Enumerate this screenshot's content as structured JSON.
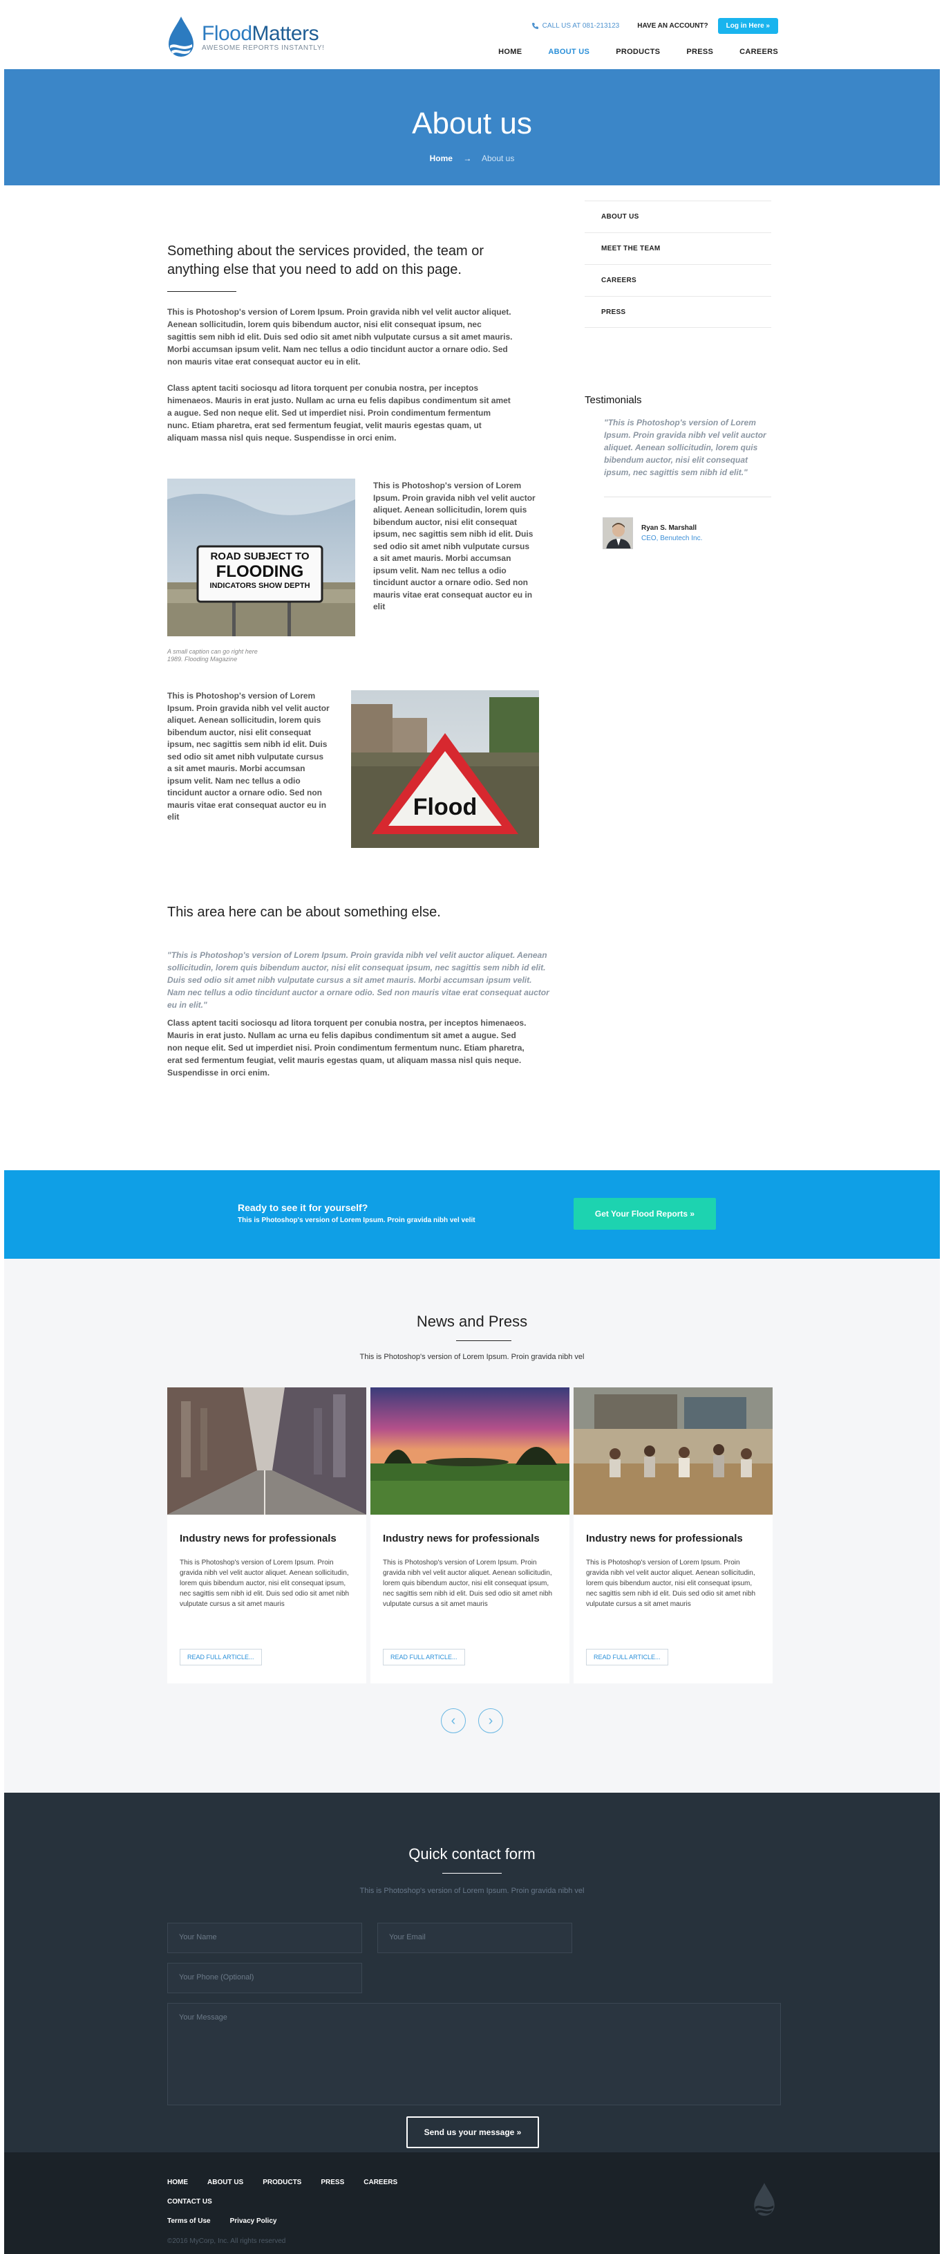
{
  "header": {
    "brand_first": "Flood",
    "brand_second": "Matters",
    "tagline": "AWESOME REPORTS INSTANTLY!",
    "call": "CALL US AT 081-213123",
    "account": "HAVE AN ACCOUNT?",
    "login": "Log in Here »",
    "nav": [
      {
        "label": "HOME",
        "active": false
      },
      {
        "label": "ABOUT US",
        "active": true
      },
      {
        "label": "PRODUCTS",
        "active": false
      },
      {
        "label": "PRESS",
        "active": false
      },
      {
        "label": "CAREERS",
        "active": false
      }
    ]
  },
  "hero": {
    "title": "About us",
    "breadcrumb_home": "Home",
    "breadcrumb_sep": "→",
    "breadcrumb_current": "About us"
  },
  "main": {
    "heading1": "Something about the services provided, the team or anything else that you need to add on this page.",
    "para1": "This is Photoshop's version of Lorem Ipsum. Proin gravida nibh vel velit auctor aliquet. Aenean sollicitudin, lorem quis bibendum auctor, nisi elit consequat ipsum, nec sagittis sem nibh id elit. Duis sed odio sit amet nibh vulputate cursus a sit amet mauris. Morbi accumsan ipsum velit. Nam nec tellus a odio tincidunt auctor a ornare odio. Sed non mauris vitae erat consequat auctor eu in elit.",
    "para2": "Class aptent taciti sociosqu ad litora torquent per conubia nostra, per inceptos himenaeos. Mauris in erat justo. Nullam ac urna eu felis dapibus condimentum sit amet a augue. Sed non neque elit. Sed ut imperdiet nisi. Proin condimentum fermentum nunc. Etiam pharetra, erat sed fermentum feugiat, velit mauris egestas quam, ut aliquam massa nisl quis neque. Suspendisse in orci enim.",
    "img1_sign": [
      "ROAD SUBJECT TO",
      "FLOODING",
      "INDICATORS SHOW DEPTH"
    ],
    "caption_line1": "A small caption can go right here",
    "caption_line2": "1989. Flooding Magazine",
    "side_text1": "This is Photoshop's version of Lorem Ipsum. Proin gravida nibh vel velit auctor aliquet. Aenean sollicitudin, lorem quis bibendum auctor, nisi elit consequat ipsum, nec sagittis sem nibh id elit. Duis sed odio sit amet nibh vulputate cursus a sit amet mauris. Morbi accumsan ipsum velit. Nam nec tellus a odio tincidunt auctor a ornare odio. Sed non mauris vitae erat consequat auctor eu in elit",
    "side_text2": "This is Photoshop's version of Lorem Ipsum. Proin gravida nibh vel velit auctor aliquet. Aenean sollicitudin, lorem quis bibendum auctor, nisi elit consequat ipsum, nec sagittis sem nibh id elit. Duis sed odio sit amet nibh vulputate cursus a sit amet mauris. Morbi accumsan ipsum velit. Nam nec tellus a odio tincidunt auctor a ornare odio. Sed non mauris vitae erat consequat auctor eu in elit",
    "img2_sign": "Flood",
    "heading2": "This area here can be about something else.",
    "quote": "\"This is Photoshop's version of Lorem Ipsum. Proin gravida nibh vel velit auctor aliquet. Aenean sollicitudin, lorem quis bibendum auctor, nisi elit consequat ipsum, nec sagittis sem nibh id elit. Duis sed odio sit amet nibh vulputate cursus a sit amet mauris. Morbi accumsan ipsum velit. Nam nec tellus a odio tincidunt auctor a ornare odio. Sed non mauris vitae erat consequat auctor eu in elit.\"",
    "para3": "Class aptent taciti sociosqu ad litora torquent per conubia nostra, per inceptos himenaeos. Mauris in erat justo. Nullam ac urna eu felis dapibus condimentum sit amet a augue. Sed non neque elit. Sed ut imperdiet nisi. Proin condimentum fermentum nunc. Etiam pharetra, erat sed fermentum feugiat, velit mauris egestas quam, ut aliquam massa nisl quis neque. Suspendisse in orci enim."
  },
  "sidebar": {
    "items": [
      "ABOUT US",
      "MEET THE TEAM",
      "CAREERS",
      "PRESS"
    ],
    "testimonials_title": "Testimonials",
    "testimonial_quote": "\"This is Photoshop's version of Lorem Ipsum. Proin gravida nibh vel velit auctor aliquet. Aenean sollicitudin, lorem quis bibendum auctor, nisi elit consequat ipsum, nec sagittis sem nibh id elit.\"",
    "person_name": "Ryan S. Marshall",
    "person_role": "CEO, Benutech Inc."
  },
  "cta": {
    "title": "Ready to see it for yourself?",
    "subtitle": "This is Photoshop's version of Lorem Ipsum. Proin gravida nibh vel velit",
    "button": "Get Your Flood Reports »"
  },
  "news": {
    "title": "News and Press",
    "subtitle": "This is Photoshop's version of Lorem Ipsum. Proin gravida nibh vel",
    "cards": [
      {
        "title": "Industry news for professionals",
        "text": "This is Photoshop's version of Lorem Ipsum. Proin gravida nibh vel velit auctor aliquet. Aenean sollicitudin, lorem quis bibendum auctor, nisi elit consequat ipsum, nec sagittis sem nibh id elit. Duis sed odio sit amet nibh vulputate cursus a sit amet mauris",
        "button": "READ FULL ARTICLE..."
      },
      {
        "title": "Industry news for professionals",
        "text": "This is Photoshop's version of Lorem Ipsum. Proin gravida nibh vel velit auctor aliquet. Aenean sollicitudin, lorem quis bibendum auctor, nisi elit consequat ipsum, nec sagittis sem nibh id elit. Duis sed odio sit amet nibh vulputate cursus a sit amet mauris",
        "button": "READ FULL ARTICLE..."
      },
      {
        "title": "Industry news for professionals",
        "text": "This is Photoshop's version of Lorem Ipsum. Proin gravida nibh vel velit auctor aliquet. Aenean sollicitudin, lorem quis bibendum auctor, nisi elit consequat ipsum, nec sagittis sem nibh id elit. Duis sed odio sit amet nibh vulputate cursus a sit amet mauris",
        "button": "READ FULL ARTICLE..."
      }
    ],
    "prev": "‹",
    "next": "›"
  },
  "contact": {
    "title": "Quick contact form",
    "subtitle": "This is Photoshop's version of Lorem Ipsum. Proin gravida nibh vel",
    "name_placeholder": "Your Name",
    "email_placeholder": "Your Email",
    "phone_placeholder": "Your Phone (Optional)",
    "message_placeholder": "Your Message",
    "send": "Send us your message »"
  },
  "footer": {
    "links_row1": [
      "HOME",
      "ABOUT US",
      "PRODUCTS",
      "PRESS",
      "CAREERS"
    ],
    "links_row2": [
      "CONTACT US"
    ],
    "links_row3": [
      "Terms of Use",
      "Privacy Policy"
    ],
    "copyright": "©2016 MyCorp, Inc. All rights reserved"
  },
  "colors": {
    "brand": "#2c7bc0",
    "hero": "#3b86c8",
    "cta": "#0f9fe6",
    "cta_button": "#1dd3b0",
    "contact_bg": "#27323c",
    "footer_bg": "#1b2228"
  }
}
